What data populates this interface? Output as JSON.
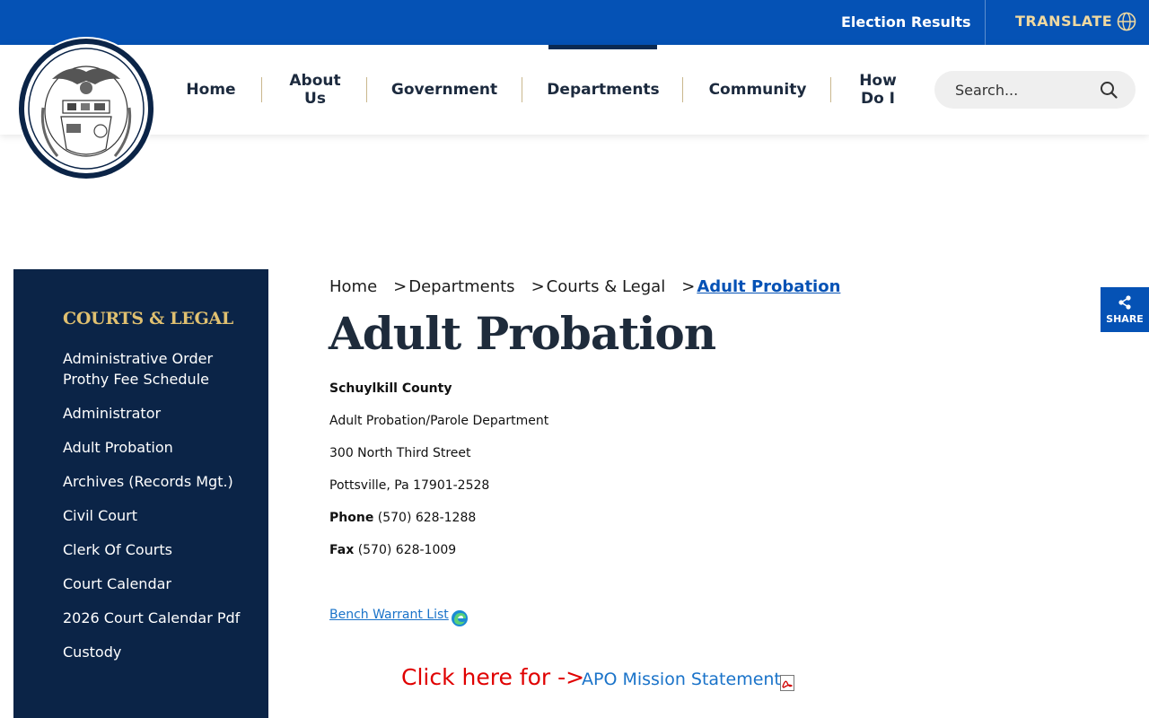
{
  "topbar": {
    "election_results": "Election Results",
    "translate": "TRANSLATE"
  },
  "header": {
    "seal_alt": "Seal of Schuylkill County Pennsylvania",
    "nav": [
      {
        "label": "Home"
      },
      {
        "label": "About Us"
      },
      {
        "label": "Government"
      },
      {
        "label": "Departments",
        "active": true
      },
      {
        "label": "Community"
      },
      {
        "label": "How Do I"
      }
    ],
    "search_placeholder": "Search..."
  },
  "sidebar": {
    "title": "COURTS & LEGAL",
    "items": [
      "Administrative Order Prothy Fee Schedule",
      "Administrator",
      "Adult Probation",
      "Archives (Records Mgt.)",
      "Civil Court",
      "Clerk Of Courts",
      "Court Calendar",
      "2026 Court Calendar Pdf",
      "Custody"
    ]
  },
  "breadcrumb": {
    "home": "Home",
    "departments": "Departments",
    "courts": "Courts & Legal",
    "current": "Adult Probation",
    "separator": ">"
  },
  "main": {
    "title": "Adult Probation",
    "org": "Schuylkill County",
    "department": "Adult Probation/Parole Department",
    "street": "300 North Third Street",
    "city": "Pottsville, Pa 17901-2528",
    "phone_label": "Phone",
    "phone": "(570) 628-1288",
    "fax_label": "Fax",
    "fax": "(570) 628-1009",
    "bench_warrant": "Bench Warrant List",
    "click_here": "Click here for ->",
    "mission_statement": "APO Mission Statement"
  },
  "share": {
    "label": "SHARE"
  },
  "colors": {
    "primary_blue": "#0552b5",
    "navy": "#0b2447",
    "gold": "#e0c070",
    "red": "#e00000"
  }
}
